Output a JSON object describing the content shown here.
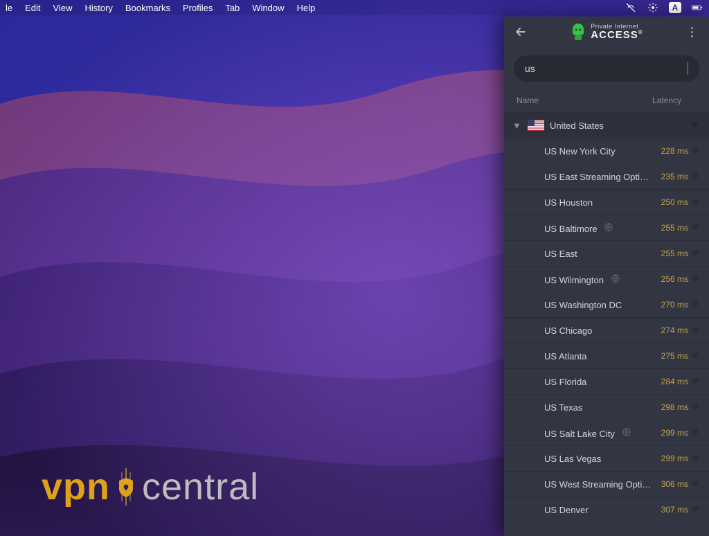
{
  "menubar": {
    "items": [
      "le",
      "Edit",
      "View",
      "History",
      "Bookmarks",
      "Profiles",
      "Tab",
      "Window",
      "Help"
    ]
  },
  "watermark": {
    "left": "vpn",
    "right": "central"
  },
  "pia": {
    "brand_top": "Private Internet",
    "brand_bottom": "ACCESS",
    "search_value": "us",
    "columns": {
      "name": "Name",
      "latency": "Latency"
    },
    "group": {
      "label": "United States"
    },
    "servers": [
      {
        "name": "US New York City",
        "latency": "228 ms",
        "geo": false
      },
      {
        "name": "US East Streaming Optimiz…",
        "latency": "235 ms",
        "geo": false
      },
      {
        "name": "US Houston",
        "latency": "250 ms",
        "geo": false
      },
      {
        "name": "US Baltimore",
        "latency": "255 ms",
        "geo": true
      },
      {
        "name": "US East",
        "latency": "255 ms",
        "geo": false
      },
      {
        "name": "US Wilmington",
        "latency": "256 ms",
        "geo": true
      },
      {
        "name": "US Washington DC",
        "latency": "270 ms",
        "geo": false
      },
      {
        "name": "US Chicago",
        "latency": "274 ms",
        "geo": false
      },
      {
        "name": "US Atlanta",
        "latency": "275 ms",
        "geo": false
      },
      {
        "name": "US Florida",
        "latency": "284 ms",
        "geo": false
      },
      {
        "name": "US Texas",
        "latency": "298 ms",
        "geo": false
      },
      {
        "name": "US Salt Lake City",
        "latency": "299 ms",
        "geo": true
      },
      {
        "name": "US Las Vegas",
        "latency": "299 ms",
        "geo": false
      },
      {
        "name": "US West Streaming Optimi…",
        "latency": "306 ms",
        "geo": false
      },
      {
        "name": "US Denver",
        "latency": "307 ms",
        "geo": false
      }
    ]
  }
}
